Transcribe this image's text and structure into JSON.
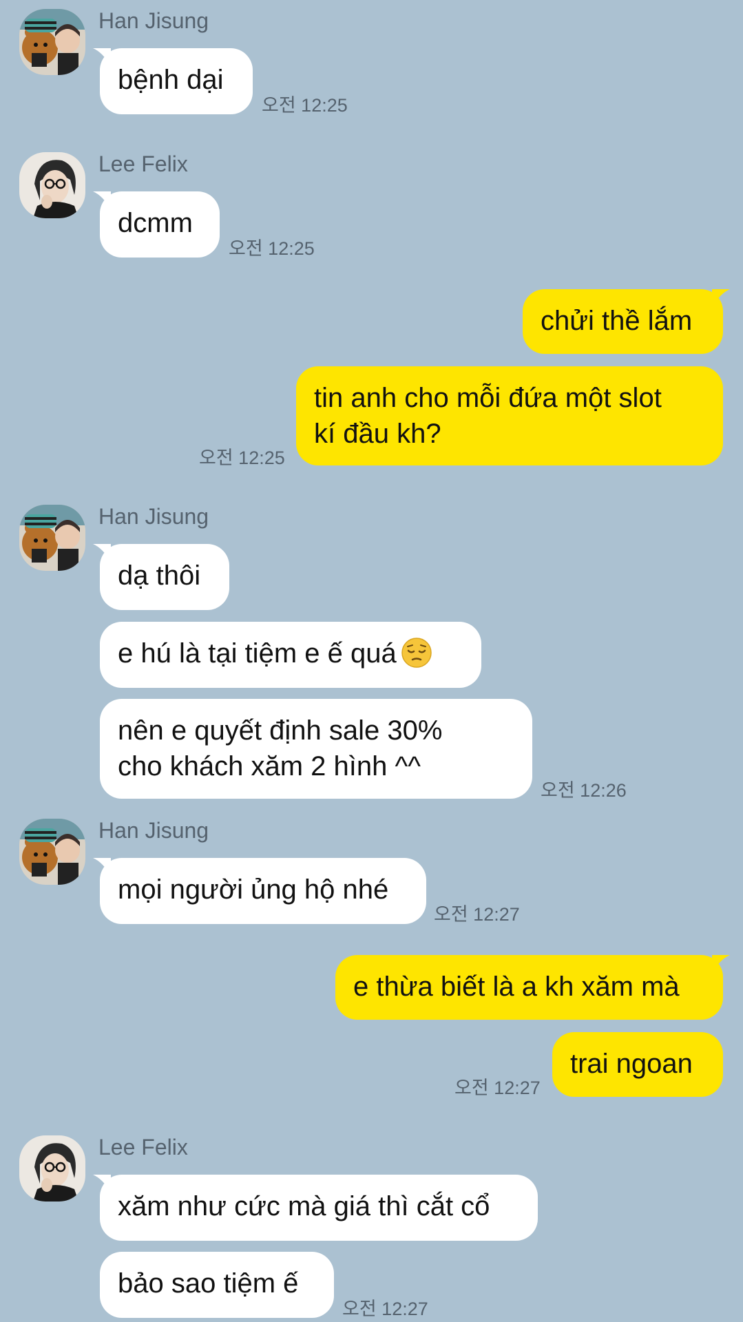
{
  "messages": [
    {
      "sender": "Han Jisung",
      "text": "bệnh dại",
      "time": "오전 12:25"
    },
    {
      "sender": "Lee Felix",
      "text": "dcmm",
      "time": "오전 12:25"
    },
    {
      "text": "chửi thề lắm"
    },
    {
      "line1": "tin anh cho mỗi đứa một slot",
      "line2": "kí đầu kh?",
      "time": "오전 12:25"
    },
    {
      "sender": "Han Jisung",
      "text": "dạ thôi"
    },
    {
      "text": "e hú là tại tiệm e ế quá",
      "emoji": "pensive-face-emoji"
    },
    {
      "line1": "nên e quyết định sale 30%",
      "line2": "cho khách xăm 2 hình ^^",
      "time": "오전 12:26"
    },
    {
      "sender": "Han Jisung",
      "text": "mọi người ủng hộ nhé",
      "time": "오전 12:27"
    },
    {
      "text": "e thừa biết là a kh xăm mà"
    },
    {
      "text": "trai ngoan",
      "time": "오전 12:27"
    },
    {
      "sender": "Lee Felix",
      "text": "xăm như cức mà giá thì cắt cổ"
    },
    {
      "text": "bảo sao tiệm ế",
      "time": "오전 12:27"
    }
  ],
  "colors": {
    "background": "#abc1d1",
    "incoming_bubble": "#ffffff",
    "outgoing_bubble": "#fee500",
    "meta_text": "#55626e"
  }
}
